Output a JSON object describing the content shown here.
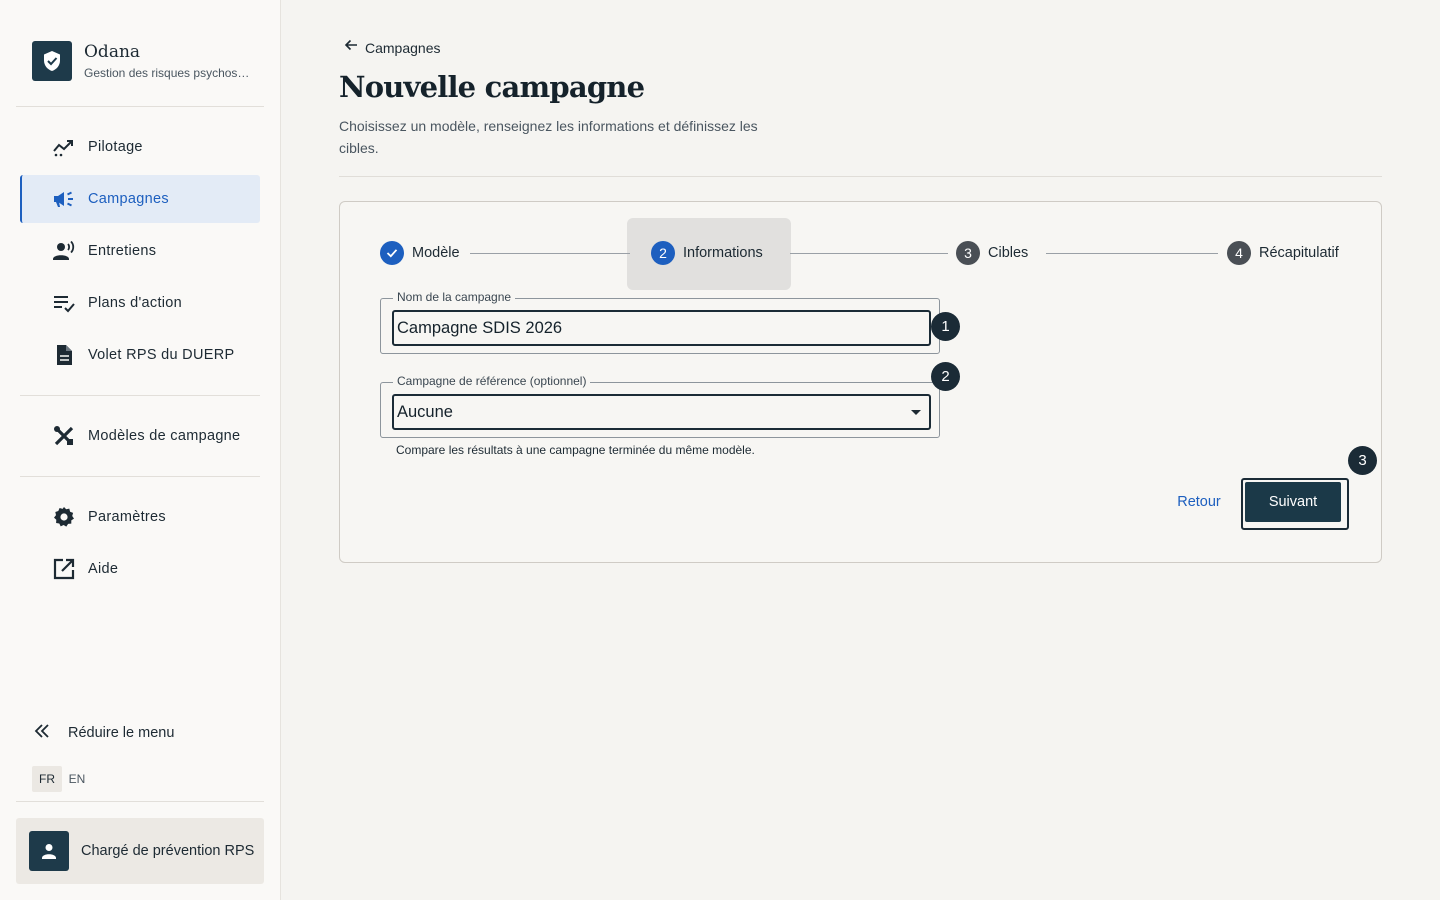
{
  "brand": {
    "name": "Odana",
    "subtitle": "Gestion des risques psychos…",
    "logo_icon": "shield-check-icon"
  },
  "nav": {
    "items": [
      {
        "label": "Pilotage",
        "icon": "trending-chart-icon",
        "active": false
      },
      {
        "label": "Campagnes",
        "icon": "megaphone-icon",
        "active": true
      },
      {
        "label": "Entretiens",
        "icon": "person-voice-icon",
        "active": false
      },
      {
        "label": "Plans d'action",
        "icon": "checklist-icon",
        "active": false
      },
      {
        "label": "Volet RPS du DUERP",
        "icon": "document-icon",
        "active": false
      }
    ],
    "secondary": [
      {
        "label": "Modèles de campagne",
        "icon": "design-tools-icon"
      }
    ],
    "tertiary": [
      {
        "label": "Paramètres",
        "icon": "gear-icon"
      },
      {
        "label": "Aide",
        "icon": "external-link-icon"
      }
    ],
    "collapse_label": "Réduire le menu",
    "languages": [
      "FR",
      "EN"
    ],
    "active_language": "FR"
  },
  "user": {
    "role": "Chargé de prévention RPS"
  },
  "page": {
    "back_label": "Campagnes",
    "title": "Nouvelle campagne",
    "subtitle": "Choisissez un modèle, renseignez les informations et définissez les cibles."
  },
  "stepper": {
    "steps": [
      {
        "number": "1",
        "label": "Modèle",
        "status": "done"
      },
      {
        "number": "2",
        "label": "Informations",
        "status": "current"
      },
      {
        "number": "3",
        "label": "Cibles",
        "status": "todo"
      },
      {
        "number": "4",
        "label": "Récapitulatif",
        "status": "todo"
      }
    ]
  },
  "form": {
    "name_field": {
      "label": "Nom de la campagne",
      "value": "Campagne SDIS 2026"
    },
    "reference_field": {
      "label": "Campagne de référence (optionnel)",
      "value": "Aucune",
      "helper": "Compare les résultats à une campagne terminée du même modèle."
    }
  },
  "annotations": [
    "1",
    "2",
    "3"
  ],
  "actions": {
    "back_label": "Retour",
    "next_label": "Suivant"
  },
  "colors": {
    "accent": "#1d5fbf",
    "dark": "#1b3948",
    "background": "#f5f4f1"
  }
}
